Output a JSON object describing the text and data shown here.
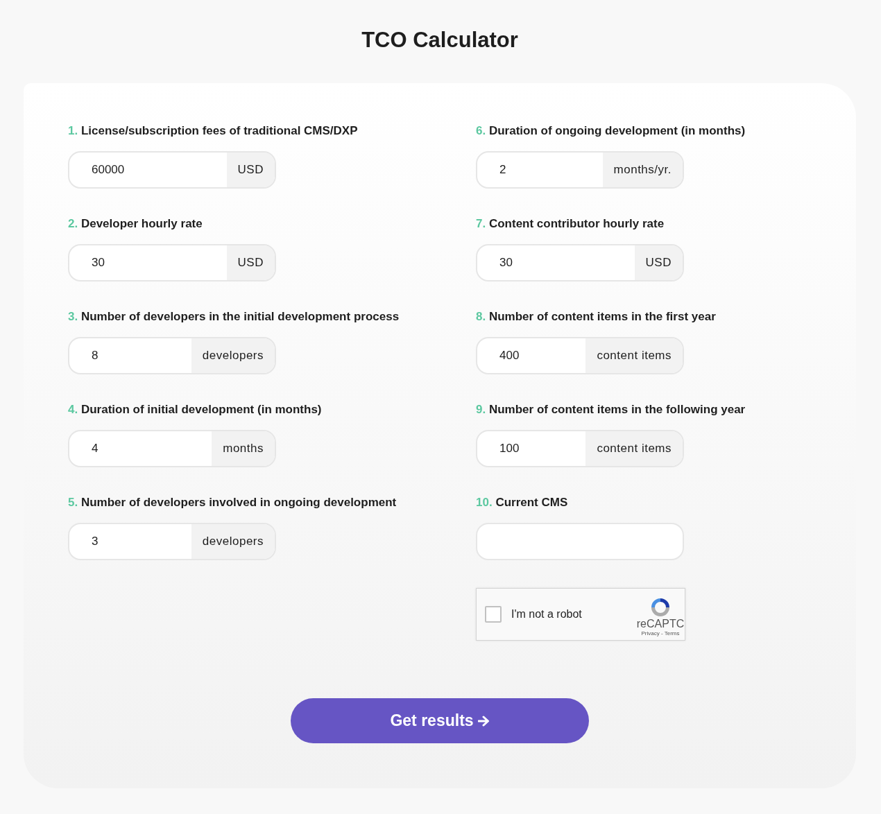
{
  "title": "TCO Calculator",
  "columns": [
    {
      "fields": [
        {
          "number": "1.",
          "label": "License/subscription fees of traditional CMS/DXP",
          "value": "60000",
          "unit": "USD"
        },
        {
          "number": "2.",
          "label": "Developer hourly rate",
          "value": "30",
          "unit": "USD"
        },
        {
          "number": "3.",
          "label": "Number of developers in the initial development process",
          "value": "8",
          "unit": "developers"
        },
        {
          "number": "4.",
          "label": "Duration of initial development (in months)",
          "value": "4",
          "unit": "months"
        },
        {
          "number": "5.",
          "label": "Number of developers involved in ongoing development",
          "value": "3",
          "unit": "developers"
        }
      ]
    },
    {
      "fields": [
        {
          "number": "6.",
          "label": "Duration of ongoing development (in months)",
          "value": "2",
          "unit": "months/yr."
        },
        {
          "number": "7.",
          "label": "Content contributor hourly rate",
          "value": "30",
          "unit": "USD"
        },
        {
          "number": "8.",
          "label": "Number of content items in the first year",
          "value": "400",
          "unit": "content items"
        },
        {
          "number": "9.",
          "label": "Number of content items in the following year",
          "value": "100",
          "unit": "content items"
        },
        {
          "number": "10.",
          "label": "Current CMS"
        }
      ]
    }
  ],
  "captcha": {
    "checked": false,
    "label": "I'm not a robot",
    "brand": "reCAPTC",
    "links": "Privacy - Terms"
  },
  "submit": {
    "label": "Get results"
  }
}
